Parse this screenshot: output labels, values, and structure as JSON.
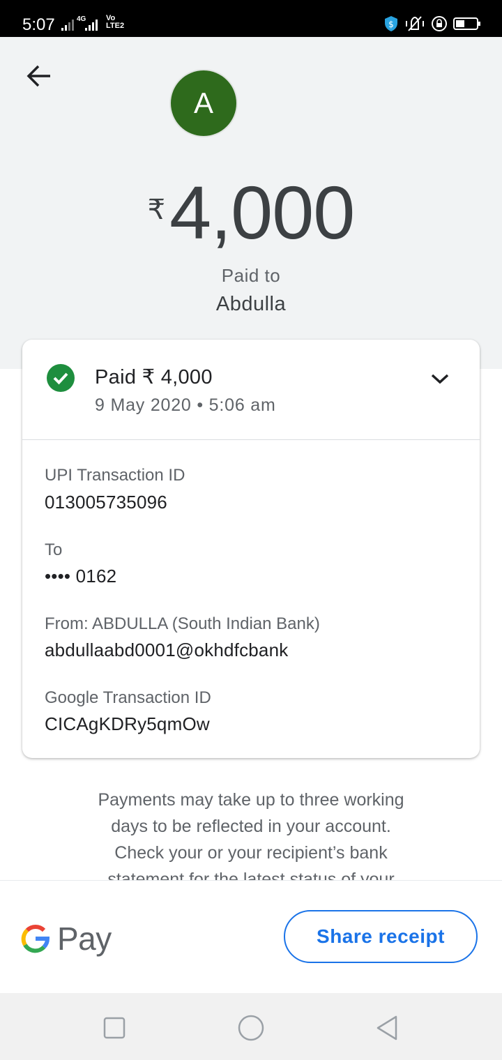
{
  "status_bar": {
    "time": "5:07",
    "network": "4G",
    "volte_line1": "Vo",
    "volte_line2": "LTE2"
  },
  "header": {
    "avatar_letter": "A",
    "avatar_color": "#2e6a1c",
    "currency_symbol": "₹",
    "amount": "4,000",
    "paid_to_label": "Paid to",
    "payee_name": "Abdulla"
  },
  "card": {
    "status_title": "Paid ₹ 4,000",
    "date_time": "9 May 2020 • 5:06 am",
    "details": [
      {
        "label": "UPI Transaction ID",
        "value": "013005735096"
      },
      {
        "label": "To",
        "value": "•••• 0162"
      },
      {
        "label": "From: ABDULLA (South Indian Bank)",
        "value": "abdullaabd0001@okhdfcbank"
      },
      {
        "label": "Google Transaction ID",
        "value": "CICAgKDRy5qmOw"
      }
    ]
  },
  "notice": {
    "line1": "Payments may take up to three working",
    "line2": "days to be reflected in your account.",
    "line3": "Check your or your recipient’s bank",
    "line4": "statement for the latest status of your"
  },
  "bottom": {
    "brand_text": "Pay",
    "share_label": "Share receipt",
    "accent_color": "#1a73e8"
  }
}
